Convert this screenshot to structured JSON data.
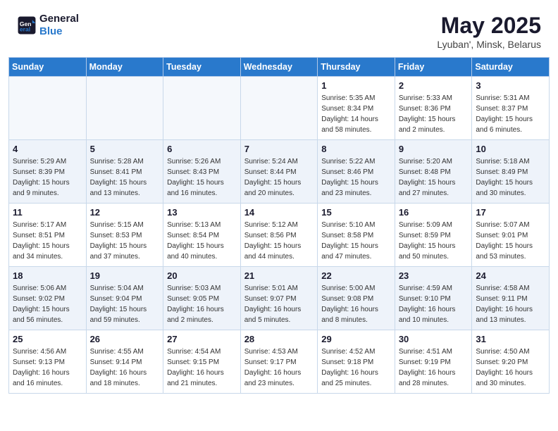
{
  "header": {
    "logo_line1": "General",
    "logo_line2": "Blue",
    "month": "May 2025",
    "location": "Lyuban', Minsk, Belarus"
  },
  "weekdays": [
    "Sunday",
    "Monday",
    "Tuesday",
    "Wednesday",
    "Thursday",
    "Friday",
    "Saturday"
  ],
  "weeks": [
    [
      {
        "day": "",
        "info": ""
      },
      {
        "day": "",
        "info": ""
      },
      {
        "day": "",
        "info": ""
      },
      {
        "day": "",
        "info": ""
      },
      {
        "day": "1",
        "info": "Sunrise: 5:35 AM\nSunset: 8:34 PM\nDaylight: 14 hours\nand 58 minutes."
      },
      {
        "day": "2",
        "info": "Sunrise: 5:33 AM\nSunset: 8:36 PM\nDaylight: 15 hours\nand 2 minutes."
      },
      {
        "day": "3",
        "info": "Sunrise: 5:31 AM\nSunset: 8:37 PM\nDaylight: 15 hours\nand 6 minutes."
      }
    ],
    [
      {
        "day": "4",
        "info": "Sunrise: 5:29 AM\nSunset: 8:39 PM\nDaylight: 15 hours\nand 9 minutes."
      },
      {
        "day": "5",
        "info": "Sunrise: 5:28 AM\nSunset: 8:41 PM\nDaylight: 15 hours\nand 13 minutes."
      },
      {
        "day": "6",
        "info": "Sunrise: 5:26 AM\nSunset: 8:43 PM\nDaylight: 15 hours\nand 16 minutes."
      },
      {
        "day": "7",
        "info": "Sunrise: 5:24 AM\nSunset: 8:44 PM\nDaylight: 15 hours\nand 20 minutes."
      },
      {
        "day": "8",
        "info": "Sunrise: 5:22 AM\nSunset: 8:46 PM\nDaylight: 15 hours\nand 23 minutes."
      },
      {
        "day": "9",
        "info": "Sunrise: 5:20 AM\nSunset: 8:48 PM\nDaylight: 15 hours\nand 27 minutes."
      },
      {
        "day": "10",
        "info": "Sunrise: 5:18 AM\nSunset: 8:49 PM\nDaylight: 15 hours\nand 30 minutes."
      }
    ],
    [
      {
        "day": "11",
        "info": "Sunrise: 5:17 AM\nSunset: 8:51 PM\nDaylight: 15 hours\nand 34 minutes."
      },
      {
        "day": "12",
        "info": "Sunrise: 5:15 AM\nSunset: 8:53 PM\nDaylight: 15 hours\nand 37 minutes."
      },
      {
        "day": "13",
        "info": "Sunrise: 5:13 AM\nSunset: 8:54 PM\nDaylight: 15 hours\nand 40 minutes."
      },
      {
        "day": "14",
        "info": "Sunrise: 5:12 AM\nSunset: 8:56 PM\nDaylight: 15 hours\nand 44 minutes."
      },
      {
        "day": "15",
        "info": "Sunrise: 5:10 AM\nSunset: 8:58 PM\nDaylight: 15 hours\nand 47 minutes."
      },
      {
        "day": "16",
        "info": "Sunrise: 5:09 AM\nSunset: 8:59 PM\nDaylight: 15 hours\nand 50 minutes."
      },
      {
        "day": "17",
        "info": "Sunrise: 5:07 AM\nSunset: 9:01 PM\nDaylight: 15 hours\nand 53 minutes."
      }
    ],
    [
      {
        "day": "18",
        "info": "Sunrise: 5:06 AM\nSunset: 9:02 PM\nDaylight: 15 hours\nand 56 minutes."
      },
      {
        "day": "19",
        "info": "Sunrise: 5:04 AM\nSunset: 9:04 PM\nDaylight: 15 hours\nand 59 minutes."
      },
      {
        "day": "20",
        "info": "Sunrise: 5:03 AM\nSunset: 9:05 PM\nDaylight: 16 hours\nand 2 minutes."
      },
      {
        "day": "21",
        "info": "Sunrise: 5:01 AM\nSunset: 9:07 PM\nDaylight: 16 hours\nand 5 minutes."
      },
      {
        "day": "22",
        "info": "Sunrise: 5:00 AM\nSunset: 9:08 PM\nDaylight: 16 hours\nand 8 minutes."
      },
      {
        "day": "23",
        "info": "Sunrise: 4:59 AM\nSunset: 9:10 PM\nDaylight: 16 hours\nand 10 minutes."
      },
      {
        "day": "24",
        "info": "Sunrise: 4:58 AM\nSunset: 9:11 PM\nDaylight: 16 hours\nand 13 minutes."
      }
    ],
    [
      {
        "day": "25",
        "info": "Sunrise: 4:56 AM\nSunset: 9:13 PM\nDaylight: 16 hours\nand 16 minutes."
      },
      {
        "day": "26",
        "info": "Sunrise: 4:55 AM\nSunset: 9:14 PM\nDaylight: 16 hours\nand 18 minutes."
      },
      {
        "day": "27",
        "info": "Sunrise: 4:54 AM\nSunset: 9:15 PM\nDaylight: 16 hours\nand 21 minutes."
      },
      {
        "day": "28",
        "info": "Sunrise: 4:53 AM\nSunset: 9:17 PM\nDaylight: 16 hours\nand 23 minutes."
      },
      {
        "day": "29",
        "info": "Sunrise: 4:52 AM\nSunset: 9:18 PM\nDaylight: 16 hours\nand 25 minutes."
      },
      {
        "day": "30",
        "info": "Sunrise: 4:51 AM\nSunset: 9:19 PM\nDaylight: 16 hours\nand 28 minutes."
      },
      {
        "day": "31",
        "info": "Sunrise: 4:50 AM\nSunset: 9:20 PM\nDaylight: 16 hours\nand 30 minutes."
      }
    ]
  ]
}
